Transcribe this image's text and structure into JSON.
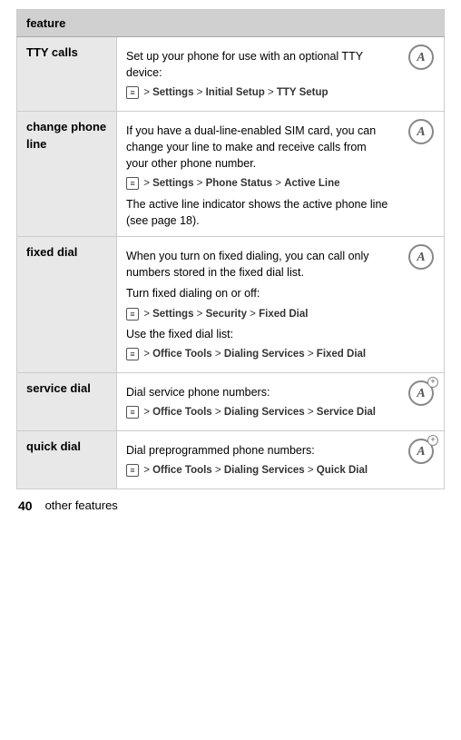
{
  "table": {
    "header": "feature",
    "rows": [
      {
        "feature": "TTY calls",
        "desc_parts": [
          {
            "type": "text",
            "value": "Set up your phone for use with an optional TTY device:"
          },
          {
            "type": "menu",
            "value": "> Settings > Initial Setup > TTY Setup"
          }
        ],
        "icon": "A",
        "icon_type": "plain"
      },
      {
        "feature": "change phone line",
        "desc_parts": [
          {
            "type": "text",
            "value": "If you have a dual-line-enabled SIM card, you can change your line to make and receive calls from your other phone number."
          },
          {
            "type": "menu",
            "value": "> Settings > Phone Status > Active Line"
          },
          {
            "type": "text",
            "value": "The active line indicator shows the active phone line (see page 18)."
          }
        ],
        "icon": "A",
        "icon_type": "plain"
      },
      {
        "feature": "fixed dial",
        "desc_parts": [
          {
            "type": "text",
            "value": "When you turn on fixed dialing, you can call only numbers stored in the fixed dial list."
          },
          {
            "type": "text",
            "value": "Turn fixed dialing on or off:"
          },
          {
            "type": "menu",
            "value": "> Settings > Security > Fixed Dial"
          },
          {
            "type": "text",
            "value": "Use the fixed dial list:"
          },
          {
            "type": "menu",
            "value": "> Office Tools > Dialing Services > Fixed Dial"
          }
        ],
        "icon": "A",
        "icon_type": "plain"
      },
      {
        "feature": "service dial",
        "desc_parts": [
          {
            "type": "text",
            "value": "Dial service phone numbers:"
          },
          {
            "type": "menu",
            "value": "> Office Tools > Dialing Services > Service Dial"
          }
        ],
        "icon": "A",
        "icon_type": "plus"
      },
      {
        "feature": "quick dial",
        "desc_parts": [
          {
            "type": "text",
            "value": "Dial preprogrammed phone numbers:"
          },
          {
            "type": "menu",
            "value": "> Office Tools > Dialing Services > Quick Dial"
          }
        ],
        "icon": "A",
        "icon_type": "plus"
      }
    ]
  },
  "footer": {
    "page_number": "40",
    "text": "other features"
  },
  "menu_segments": {
    "Settings": "Settings",
    "InitialSetup": "Initial Setup",
    "TTYSetup": "TTY Setup",
    "PhoneStatus": "Phone Status",
    "ActiveLine": "Active Line",
    "Security": "Security",
    "FixedDial": "Fixed Dial",
    "OfficeTools": "Office Tools",
    "DialingServices": "Dialing Services",
    "ServiceDial": "Service Dial",
    "QuickDial": "Quick Dial"
  }
}
